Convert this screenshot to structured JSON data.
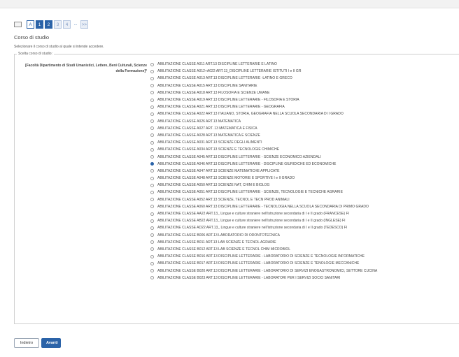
{
  "pager": {
    "items": [
      "A",
      "1",
      "2",
      "3",
      "4",
      "...",
      ">>"
    ]
  },
  "section": {
    "title": "Corso di studio",
    "subtitle": "Selezionare il corso di studio al quale si intende accedere.",
    "legend": "Scelta corso di studio:",
    "group_label": "[Facoltà Dipartimento di Studi Umanistici, Lettere, Beni Culturali, Scienze della Formazione]*"
  },
  "options": [
    {
      "label": "ABILITAZIONE CLASSE A011 ART.13 DISCIPLINE LETTERARIE E LATINO",
      "selected": false
    },
    {
      "label": "ABILITAZIONE CLASSE A012+A022 ART.13_DISCIPLINE LETTERARIE ISTITUTI I e II GR",
      "selected": false
    },
    {
      "label": "ABILITAZIONE CLASSE A013 ART.13 DISCIPLINE LETTERARIE -LATINO E GRECO",
      "selected": false
    },
    {
      "label": "ABILITAZIONE CLASSE A015 ART.13 DISCIPLINE SANITARIE",
      "selected": false
    },
    {
      "label": "ABILITAZIONE CLASSE A018 ART.13 FILOSOFIA E SCIENZE UMANE",
      "selected": false
    },
    {
      "label": "ABILITAZIONE CLASSE A019 ART.13 DISCIPLINE LETTERARIE - FILOSOFIA E STORIA",
      "selected": false
    },
    {
      "label": "ABILITAZIONE CLASSE A021 ART.13 DISCIPLINE LETTERARIE - GEOGRAFIA",
      "selected": false
    },
    {
      "label": "ABILITAZIONE CLASSE A022 ART.13 ITALIANO, STORIA, GEOGRAFIA NELLA SCUOLA SECONDARIA DI I GRADO",
      "selected": false
    },
    {
      "label": "ABILITAZIONE CLASSE A026 ART.13 MATEMATICA",
      "selected": false
    },
    {
      "label": "ABILITAZIONE CLASSE A027 ART. 13 MATEMATICA E FISICA",
      "selected": false
    },
    {
      "label": "ABILITAZIONE CLASSE A028 ART.13 MATEMATICA E SCIENZE",
      "selected": false
    },
    {
      "label": "ABILITAZIONE CLASSE A031 ART.13 SCIENZE DEGLI ALIMENTI",
      "selected": false
    },
    {
      "label": "ABILITAZIONE CLASSE A034 ART.13 SCIENZE E TECNOLOGIE CHIMICHE",
      "selected": false
    },
    {
      "label": "ABILITAZIONE CLASSE A045 ART.13 DISCIPLINE LETTERARIE - SCIENZE ECONOMICO AZIENDALI",
      "selected": false
    },
    {
      "label": "ABILITAZIONE CLASSE A046 ART.13 DISCIPLINE LETTERARIE - DISCIPLINE GIURIDICHE ED ECONOMICHE",
      "selected": true
    },
    {
      "label": "ABILITAZIONE CLASSE A047 ART.13 SCIENZE MATEMATICHE APPLICATE",
      "selected": false
    },
    {
      "label": "ABILITAZIONE CLASSE A048 ART.13 SCIENZE MOTORIE E SPORTIVE I e II GRADO",
      "selected": false
    },
    {
      "label": "ABILITAZIONE CLASSE A050 ART.13 SCIENZE NAT, CHIM E BIOLOG",
      "selected": false
    },
    {
      "label": "ABILITAZIONE CLASSE A051 ART.13 DISCIPLINE LETTERARIE - SCIENZE, TECNOLOGIE E TECNICHE AGRARIE",
      "selected": false
    },
    {
      "label": "ABILITAZIONE CLASSE A052 ART.13 SCIENZE, TECNOL E TECN PROD ANIMALI",
      "selected": false
    },
    {
      "label": "ABILITAZIONE CLASSE A060 ART.13 DISCIPLINE LETTERARIE - TECNOLOGIA NELLA SCUOLA SECONDARIA DI PRIMO GRADO",
      "selected": false
    },
    {
      "label": "ABILITAZIONE CLASSE AA22 ART.13_ Lingue e culture straniere nell'istruzione secondaria di I e II grado (FRANCESE) FI",
      "selected": false
    },
    {
      "label": "ABILITAZIONE CLASSE AB22 ART.13_ Lingue e culture straniere nell'istruzione secondaria di I e II grado (INGLESE) FI",
      "selected": false
    },
    {
      "label": "ABILITAZIONE CLASSE AD22 ART.13_ Lingue e culture straniere nell'istruzione secondaria di I e II grado (TEDESCO) FI",
      "selected": false
    },
    {
      "label": "ABILITAZIONE CLASSE B006 ART.13 LABORATORIO DI ODONTOTECNICA",
      "selected": false
    },
    {
      "label": "ABILITAZIONE CLASSE B011 ART.13 LAB SCIENZE E TECNOL AGRARIE",
      "selected": false
    },
    {
      "label": "ABILITAZIONE CLASSE B012 ART.13 LAB SCIENZE E TECNOL CHIM MICROBIOL",
      "selected": false
    },
    {
      "label": "ABILITAZIONE CLASSE B016 ART.13 DISCIPLINE LETTERARIE - LABORATORIO DI SCIENZE E TECNOLOGIE INFORMATICHE",
      "selected": false
    },
    {
      "label": "ABILITAZIONE CLASSE B017 ART.13 DISCIPLINE LETTERARIE - LABORATORIO DI SCIENZE E TENOLOGIE MECCANICHE",
      "selected": false
    },
    {
      "label": "ABILITAZIONE CLASSE B020 ART.13 DISCIPLINE LETTERARIE - LABORATORIO DI SERVIZI ENOGASTRONOMICI, SETTORE CUCINA",
      "selected": false
    },
    {
      "label": "ABILITAZIONE CLASSE B023 ART.13 DISCIPLINE LETTERARIE - LABORATORI PER I SERVIZI SOCIO SANITARI",
      "selected": false
    }
  ],
  "buttons": {
    "back": "Indietro",
    "next": "Avanti"
  },
  "colors": {
    "accent": "#2b63a8"
  }
}
